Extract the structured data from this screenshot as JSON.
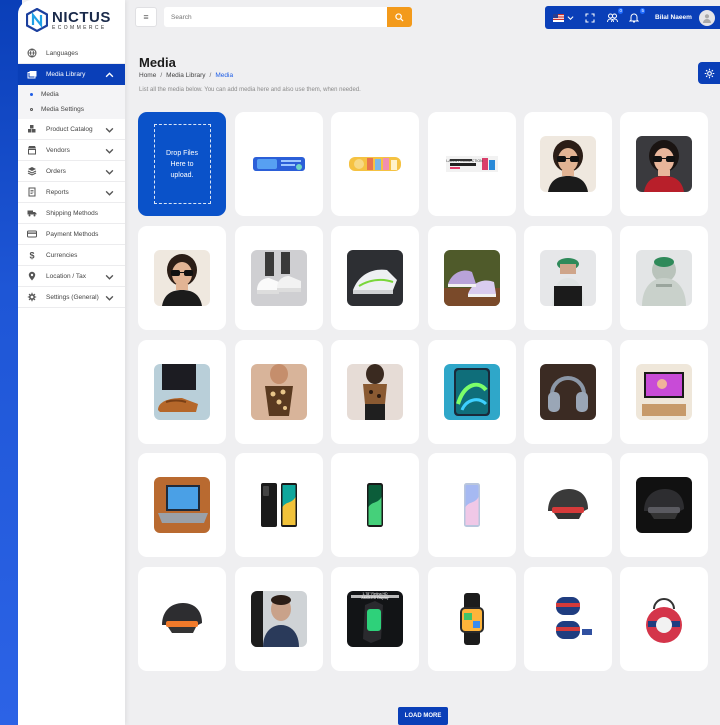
{
  "brand": {
    "name": "NICTUS",
    "sub": "ECOMMERCE"
  },
  "sidebar": {
    "items": [
      {
        "label": "Languages",
        "icon": "globe-icon"
      },
      {
        "label": "Media Library",
        "icon": "media-icon",
        "active": true
      },
      {
        "label": "Product Catalog",
        "icon": "boxes-icon"
      },
      {
        "label": "Vendors",
        "icon": "store-icon"
      },
      {
        "label": "Orders",
        "icon": "layers-icon"
      },
      {
        "label": "Reports",
        "icon": "report-icon"
      },
      {
        "label": "Shipping Methods",
        "icon": "truck-icon"
      },
      {
        "label": "Payment Methods",
        "icon": "card-icon"
      },
      {
        "label": "Currencies",
        "icon": "dollar-icon"
      },
      {
        "label": "Location / Tax",
        "icon": "pin-icon"
      },
      {
        "label": "Settings (General)",
        "icon": "gear-icon"
      }
    ],
    "subitems": [
      {
        "label": "Media",
        "active": true
      },
      {
        "label": "Media Settings",
        "active": false
      }
    ]
  },
  "topbar": {
    "search_placeholder": "Search",
    "notification_badges": [
      "0",
      "5"
    ],
    "user_name": "Bilal Naeem"
  },
  "page": {
    "title": "Media",
    "breadcrumb": [
      "Home",
      "Media Library",
      "Media"
    ],
    "description": "List all the media below. You can add media here and also use them, when needed."
  },
  "dropzone": {
    "text": "Drop Files Here to upload."
  },
  "media": [
    {
      "kind": "banner-blue"
    },
    {
      "kind": "banner-yellow"
    },
    {
      "kind": "banner-collection",
      "label": "LATEST COLLECTION"
    },
    {
      "kind": "woman-sunglasses"
    },
    {
      "kind": "woman-sunglasses-dark"
    },
    {
      "kind": "woman-sunglasses"
    },
    {
      "kind": "white-sneakers"
    },
    {
      "kind": "sneaker-dark"
    },
    {
      "kind": "sneakers-pair"
    },
    {
      "kind": "person-cap"
    },
    {
      "kind": "person-hoodie"
    },
    {
      "kind": "loafers"
    },
    {
      "kind": "halter-top"
    },
    {
      "kind": "leopard-top"
    },
    {
      "kind": "tablet-green"
    },
    {
      "kind": "headphones"
    },
    {
      "kind": "tv-stand"
    },
    {
      "kind": "laptop"
    },
    {
      "kind": "phone-dual"
    },
    {
      "kind": "phone-green"
    },
    {
      "kind": "phone-blue"
    },
    {
      "kind": "helmet-set"
    },
    {
      "kind": "helmet-dark"
    },
    {
      "kind": "helmet-orange"
    },
    {
      "kind": "earbuds-man"
    },
    {
      "kind": "smartwatch-promo",
      "label": "1.78\" Retina HD AMOLED Display"
    },
    {
      "kind": "smartwatch"
    },
    {
      "kind": "bag-set"
    },
    {
      "kind": "bag-red"
    }
  ],
  "load_more": "LOAD MORE",
  "colors": {
    "primary": "#0a3fb8",
    "accent": "#f39a1b",
    "dropzone": "#0a52c9"
  }
}
